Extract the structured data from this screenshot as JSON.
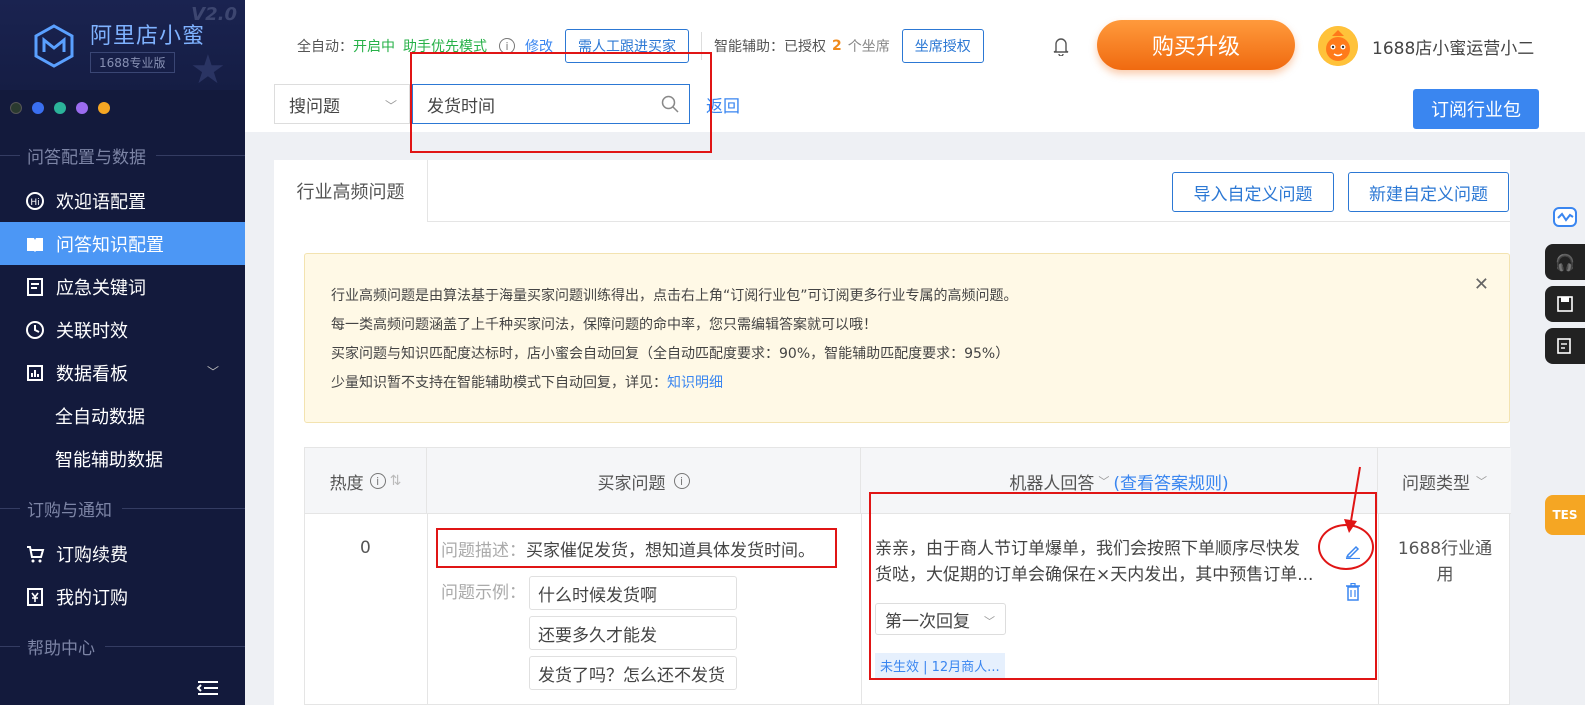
{
  "app": {
    "title": "阿里店小蜜",
    "edition": "1688专业版",
    "version": "V2.0",
    "theme_dots": [
      "#2a3a2f",
      "#3a6ff0",
      "#2bb39a",
      "#9b6cf0",
      "#f5a623"
    ]
  },
  "sidebar": {
    "sections": [
      {
        "label": "问答配置与数据"
      },
      {
        "label": "订购与通知"
      },
      {
        "label": "帮助中心"
      }
    ],
    "items": [
      {
        "label": "欢迎语配置",
        "icon": "hi-icon"
      },
      {
        "label": "问答知识配置",
        "icon": "book-icon"
      },
      {
        "label": "应急关键词",
        "icon": "doc-icon"
      },
      {
        "label": "关联时效",
        "icon": "clock-icon"
      },
      {
        "label": "数据看板",
        "icon": "chart-icon"
      },
      {
        "label": "全自动数据"
      },
      {
        "label": "智能辅助数据"
      },
      {
        "label": "订购续费",
        "icon": "cart-icon"
      },
      {
        "label": "我的订购",
        "icon": "yen-icon"
      }
    ]
  },
  "header": {
    "auto_label": "全自动：",
    "auto_status": "开启中",
    "auto_mode": "助手优先模式",
    "modify_link": "修改",
    "need_human_button": "需人工跟进买家",
    "assist_label": "智能辅助：已授权",
    "assist_count": "2",
    "assist_unit": "个坐席",
    "seat_auth_button": "坐席授权",
    "buy_button": "购买升级",
    "user_name": "1688店小蜜运营小二"
  },
  "search": {
    "type_select": "搜问题",
    "query": "发货时间",
    "back_link": "返回",
    "subscribe_button": "订阅行业包"
  },
  "card": {
    "tab": "行业高频问题",
    "import_button": "导入自定义问题",
    "new_button": "新建自定义问题",
    "notice_lines": [
      "行业高频问题是由算法基于海量买家问题训练得出，点击右上角“订阅行业包”可订阅更多行业专属的高频问题。",
      "每一类高频问题涵盖了上千种买家问法，保障问题的命中率，您只需编辑答案就可以哦！",
      "买家问题与知识匹配度达标时，店小蜜会自动回复（全自动匹配度要求：90%，智能辅助匹配度要求：95%）",
      "少量知识暂不支持在智能辅助模式下自动回复，详见："
    ],
    "notice_link": "知识明细"
  },
  "table": {
    "headers": {
      "heat": "热度",
      "question": "买家问题",
      "answer": "机器人回答",
      "answer_rule": "(查看答案规则)",
      "type": "问题类型"
    },
    "rows": [
      {
        "heat": "0",
        "desc_label": "问题描述：",
        "desc": "买家催促发货，想知道具体发货时间。",
        "example_label": "问题示例：",
        "examples": [
          "什么时候发货啊",
          "还要多久才能发",
          "发货了吗？怎么还不发货"
        ],
        "answer": "亲亲，由于商人节订单爆单，我们会按照下单顺序尽快发货哒，大促期的订单会确保在×天内发出，其中预售订单...",
        "reply_select": "第一次回复",
        "status_tag": "未生效 | 12月商人...",
        "type": "1688行业通用"
      }
    ]
  },
  "floating": {
    "test_tag": "TES"
  },
  "colors": {
    "sidebar_bg": "#131a3c",
    "active_item": "#4c97f5",
    "primary": "#3a86f0",
    "annotation_red": "#e01515",
    "buy_orange": "#f06a10"
  }
}
